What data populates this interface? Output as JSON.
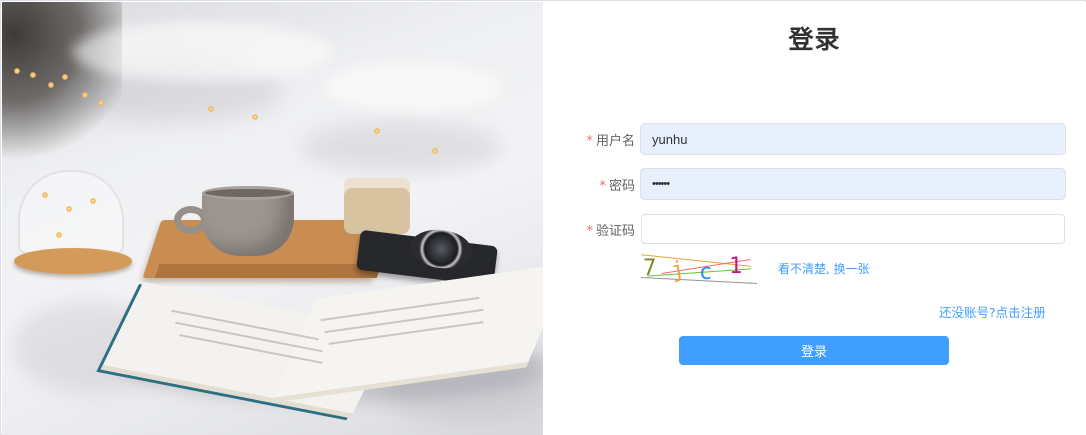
{
  "login": {
    "title": "登录",
    "username": {
      "label": "用户名",
      "value": "yunhu"
    },
    "password": {
      "label": "密码",
      "value": "••••••"
    },
    "captcha": {
      "label": "验证码",
      "value": "",
      "image_text": [
        "7",
        "j",
        "c",
        "1"
      ],
      "refresh_link": "看不清楚, 换一张"
    },
    "register_link": "还没账号?点击注册",
    "submit_label": "登录"
  },
  "colors": {
    "accent": "#409eff",
    "required_star": "#f56c6c",
    "autofill_bg": "#e8f0fe",
    "title": "#303133"
  },
  "photo": {
    "icon": "background-photo-bed-coffee-book"
  }
}
